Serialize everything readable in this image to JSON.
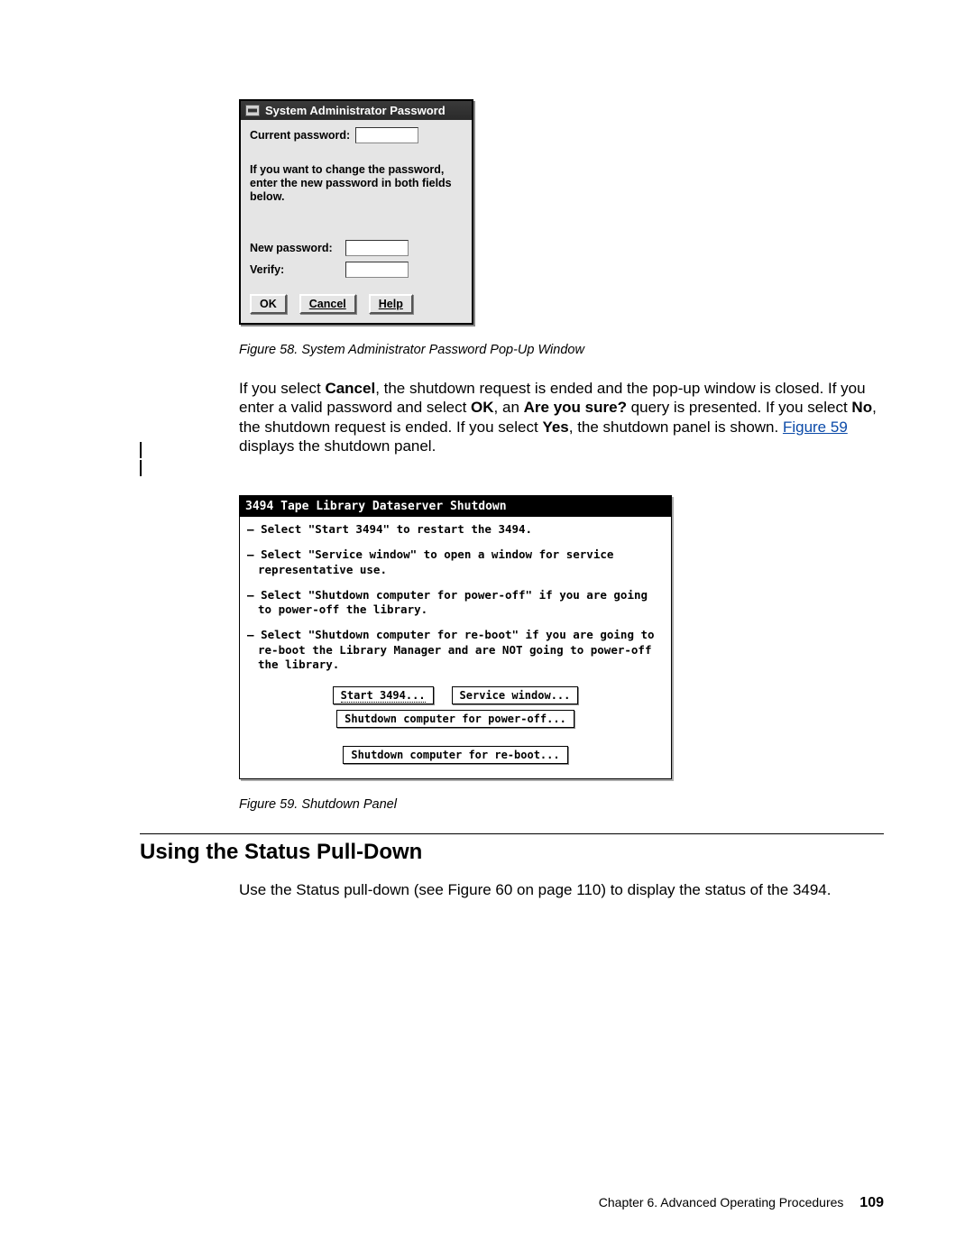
{
  "password_dialog": {
    "title": "System Administrator Password",
    "current_label": "Current password:",
    "instruction": "If you want to change the password, enter the new password in both fields below.",
    "new_label": "New password:",
    "verify_label": "Verify:",
    "ok": "OK",
    "cancel": "Cancel",
    "help": "Help"
  },
  "fig58_caption": "Figure 58. System Administrator Password Pop-Up Window",
  "para1_parts": {
    "p1": "If you select ",
    "b1": "Cancel",
    "p2": ", the shutdown request is ended and the pop-up window is closed. If you enter a valid password and select ",
    "b2": "OK",
    "p3": ", an ",
    "b3": "Are you sure?",
    "p4": " query is presented. If you select ",
    "b4": "No",
    "p5": ", the shutdown request is ended. If you select ",
    "b5": "Yes",
    "p6": ", the shutdown panel is shown. ",
    "link": "Figure 59",
    "p7": " displays the shutdown panel."
  },
  "shutdown_dialog": {
    "title": "3494 Tape Library Dataserver Shutdown",
    "items": [
      "Select \"Start 3494\" to restart the 3494.",
      "Select \"Service window\" to open a window for service representative use.",
      "Select \"Shutdown computer for power-off\" if you are going to power-off the library.",
      "Select \"Shutdown computer for re-boot\" if you are going to re-boot the Library Manager and are NOT going to power-off the library."
    ],
    "btn_start": "Start 3494...",
    "btn_service": "Service window...",
    "btn_poweroff": "Shutdown computer for power-off...",
    "btn_reboot": "Shutdown computer for re-boot..."
  },
  "fig59_caption": "Figure 59. Shutdown Panel",
  "section_heading": "Using the Status Pull-Down",
  "para2": "Use the Status pull-down (see Figure 60 on page 110) to display the status of the 3494.",
  "footer_chapter": "Chapter 6. Advanced Operating Procedures",
  "footer_page": "109"
}
